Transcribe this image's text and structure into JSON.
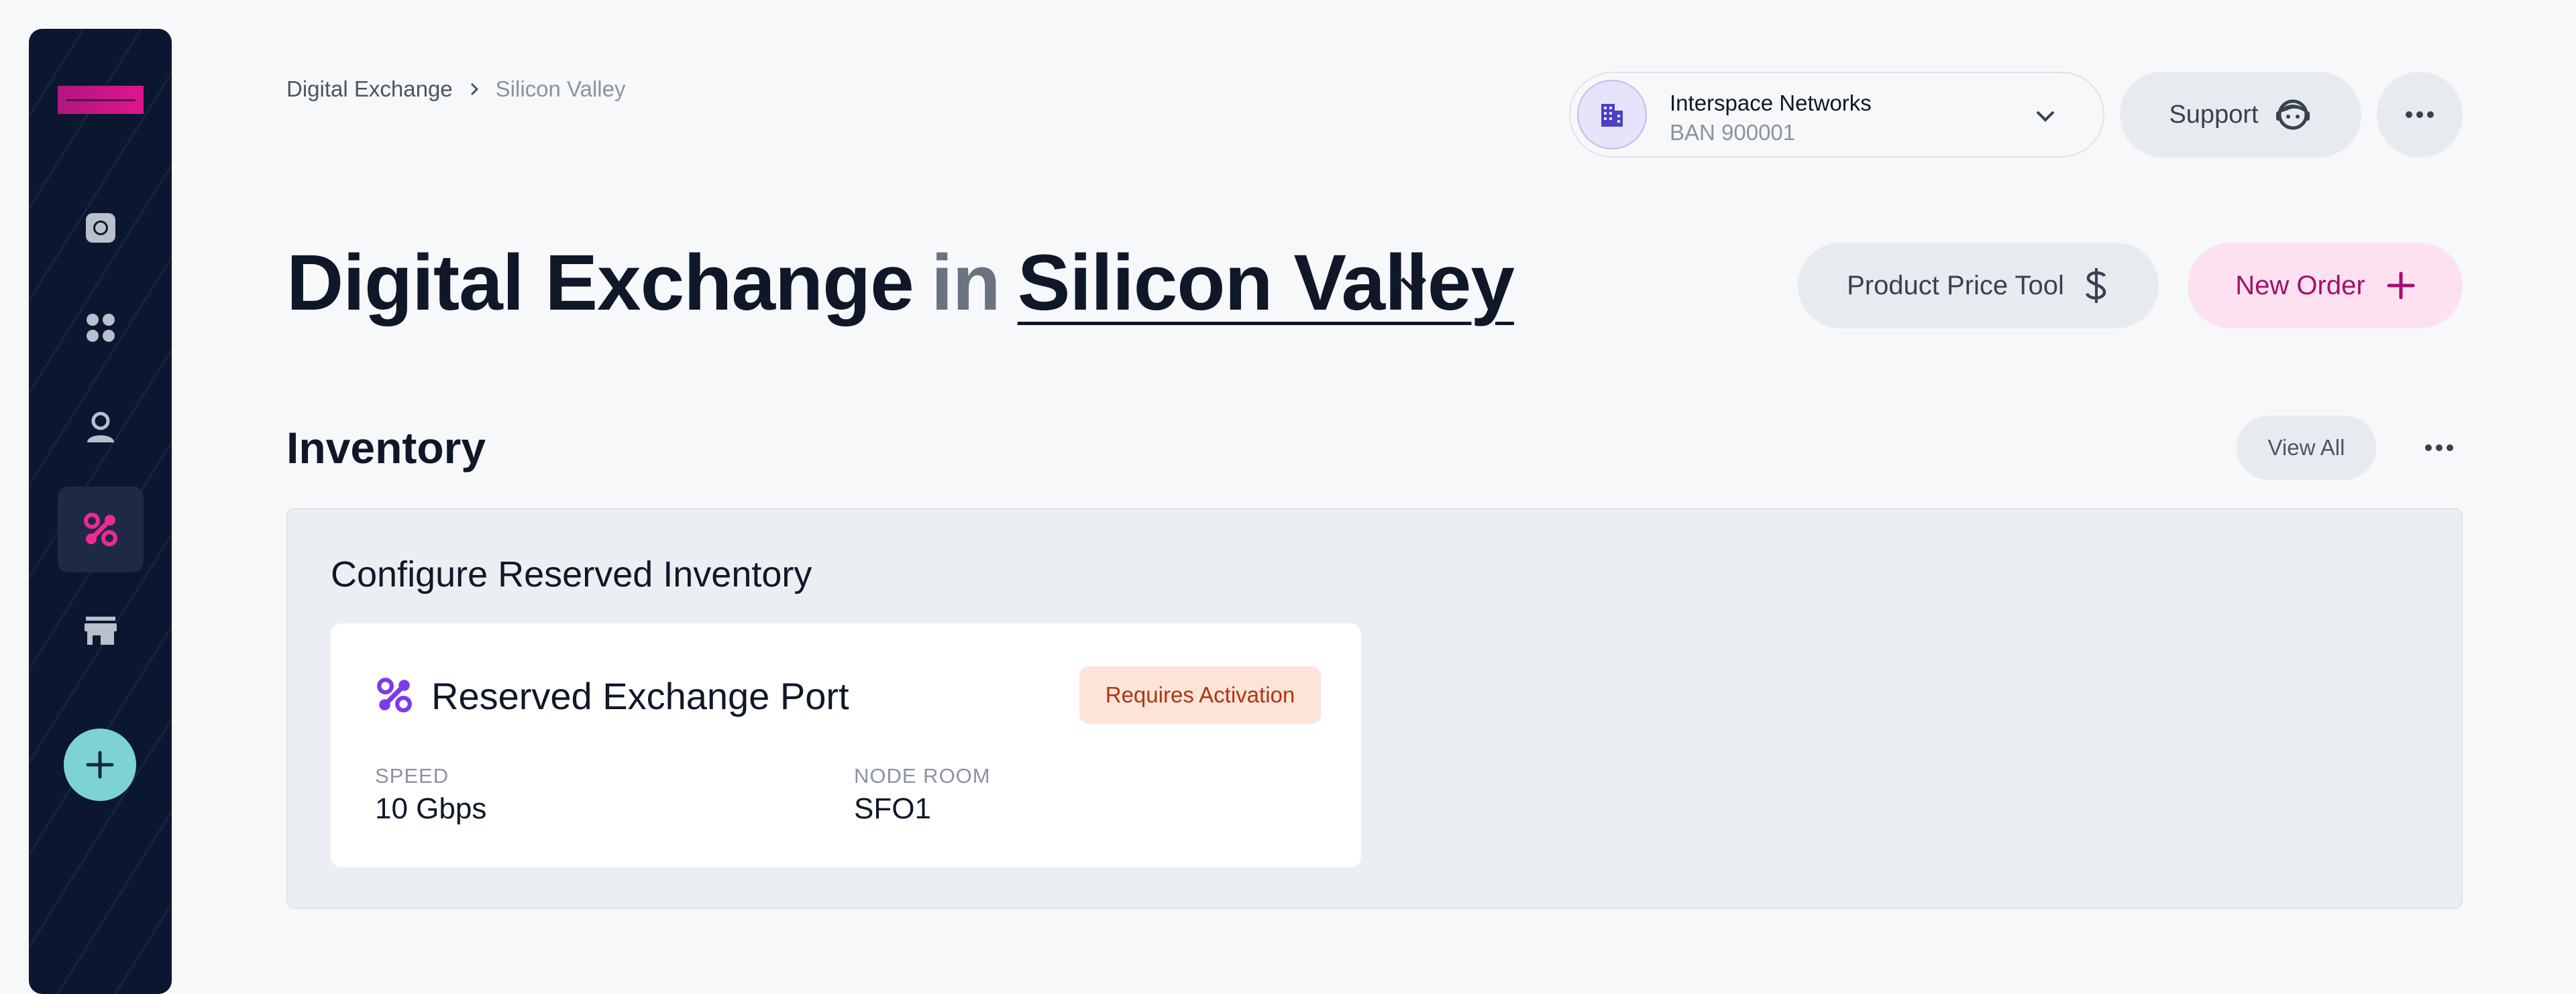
{
  "sidebar": {
    "items": [
      {
        "name": "dashboard",
        "icon": "record-icon",
        "active": false
      },
      {
        "name": "apps",
        "icon": "grid-dots-icon",
        "active": false
      },
      {
        "name": "users",
        "icon": "user-icon",
        "active": false
      },
      {
        "name": "exchange",
        "icon": "exchange-icon",
        "active": true
      },
      {
        "name": "marketplace",
        "icon": "store-icon",
        "active": false
      }
    ],
    "add_icon": "plus-icon"
  },
  "breadcrumb": {
    "items": [
      "Digital Exchange",
      "Silicon Valley"
    ]
  },
  "account": {
    "name": "Interspace Networks",
    "ban": "BAN 900001"
  },
  "header": {
    "support_label": "Support",
    "title_main": "Digital Exchange",
    "title_in": "in",
    "title_location": "Silicon Valley",
    "price_tool_label": "Product Price Tool",
    "new_order_label": "New Order"
  },
  "inventory": {
    "section_title": "Inventory",
    "view_all_label": "View All",
    "panel_title": "Configure Reserved Inventory",
    "card": {
      "title": "Reserved Exchange Port",
      "status": "Requires Activation",
      "fields": [
        {
          "label": "SPEED",
          "value": "10 Gbps"
        },
        {
          "label": "NODE ROOM",
          "value": "SFO1"
        }
      ]
    }
  },
  "colors": {
    "sidebar_bg": "#0b1731",
    "accent_pink": "#e0158f",
    "accent_teal": "#7dd3d1",
    "badge_bg": "#fde4d9",
    "badge_text": "#b2330f",
    "icon_purple": "#7c3aed"
  }
}
